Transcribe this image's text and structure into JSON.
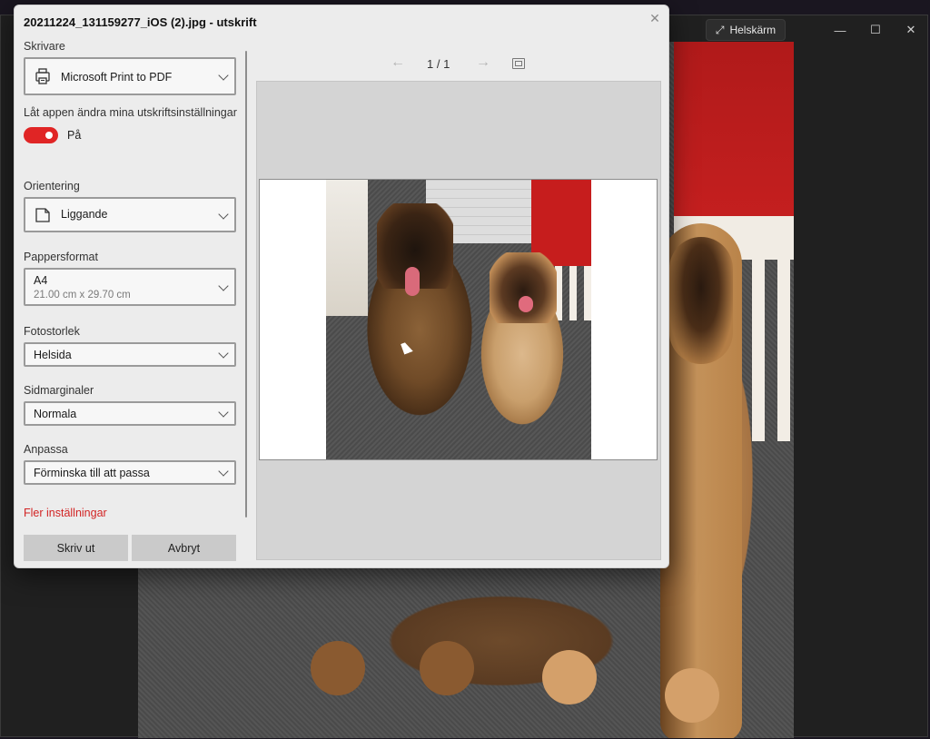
{
  "viewer": {
    "fullscreen_label": "Helskärm",
    "fullscreen_icon": "expand-diagonal-icon",
    "minimize_glyph": "—",
    "maximize_glyph": "☐",
    "close_glyph": "✕"
  },
  "dialog": {
    "title": "20211224_131159277_iOS (2).jpg - utskrift",
    "close_glyph": "✕",
    "printer": {
      "label": "Skrivare",
      "value": "Microsoft Print to PDF",
      "icon": "printer-icon"
    },
    "app_settings": {
      "label": "Låt appen ändra mina utskriftsinställningar",
      "state_text": "På",
      "accent": "#e02525"
    },
    "orientation": {
      "label": "Orientering",
      "value": "Liggande",
      "icon": "page-landscape-icon"
    },
    "paper_size": {
      "label": "Pappersformat",
      "value": "A4",
      "detail": "21.00 cm x 29.70 cm"
    },
    "photo_size": {
      "label": "Fotostorlek",
      "value": "Helsida"
    },
    "margins": {
      "label": "Sidmarginaler",
      "value": "Normala"
    },
    "fit": {
      "label": "Anpassa",
      "value": "Förminska till att passa"
    },
    "more_settings": "Fler inställningar",
    "print_button": "Skriv ut",
    "cancel_button": "Avbryt",
    "preview": {
      "page_counter": "1 / 1",
      "prev_glyph": "←",
      "next_glyph": "→"
    }
  }
}
